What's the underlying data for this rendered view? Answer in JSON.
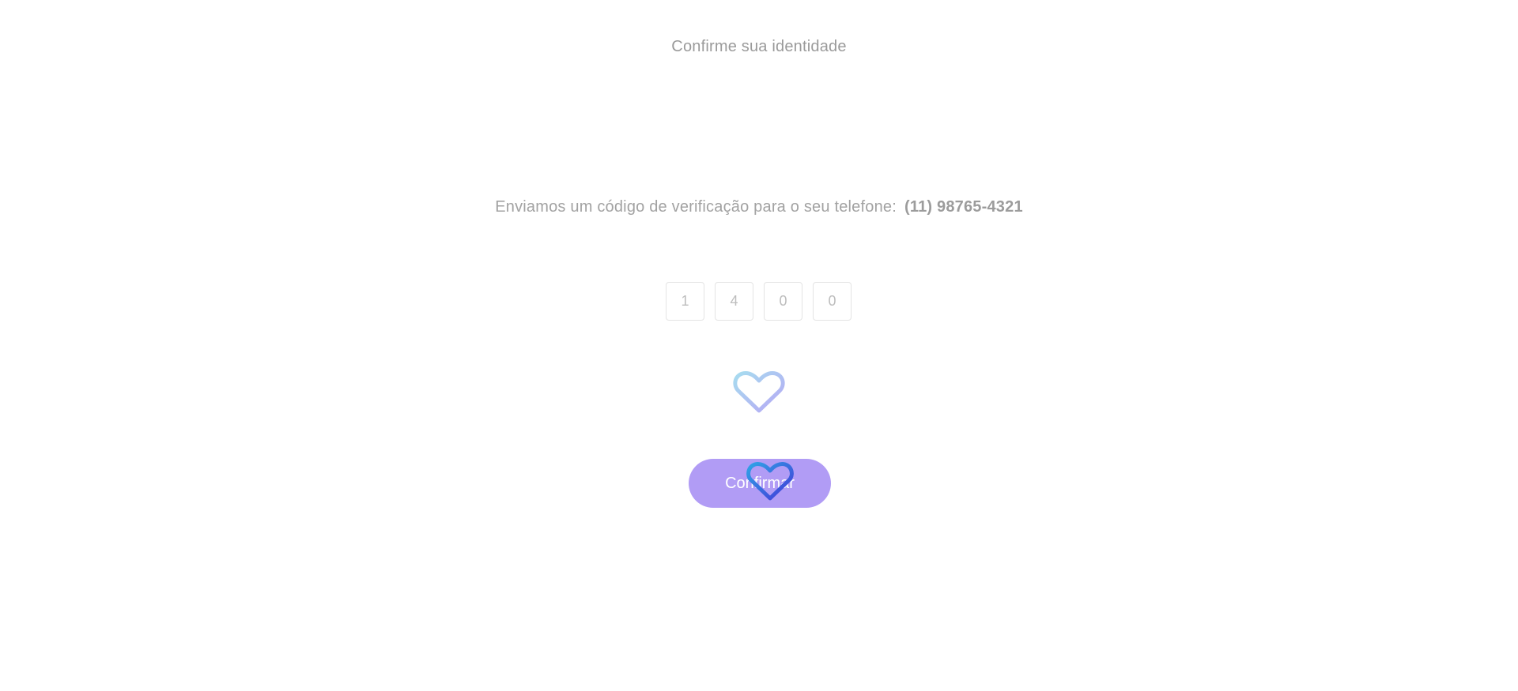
{
  "header": {
    "title": "Confirme sua identidade"
  },
  "verification": {
    "message": "Enviamos um código de verificação para o seu telefone:",
    "phone": "(11) 98765-4321",
    "code_digits": [
      "1",
      "4",
      "0",
      "0"
    ]
  },
  "actions": {
    "confirm_label": "Confirmar"
  },
  "icons": {
    "loader": "heart-icon",
    "overlay": "heart-icon"
  },
  "colors": {
    "button_background": "#b19cf5",
    "text_muted": "#9a9a9a",
    "heart_light_start": "#a7dcef",
    "heart_light_end": "#b6a8f5",
    "heart_dark_start": "#2fa3e6",
    "heart_dark_end": "#4338d8"
  }
}
